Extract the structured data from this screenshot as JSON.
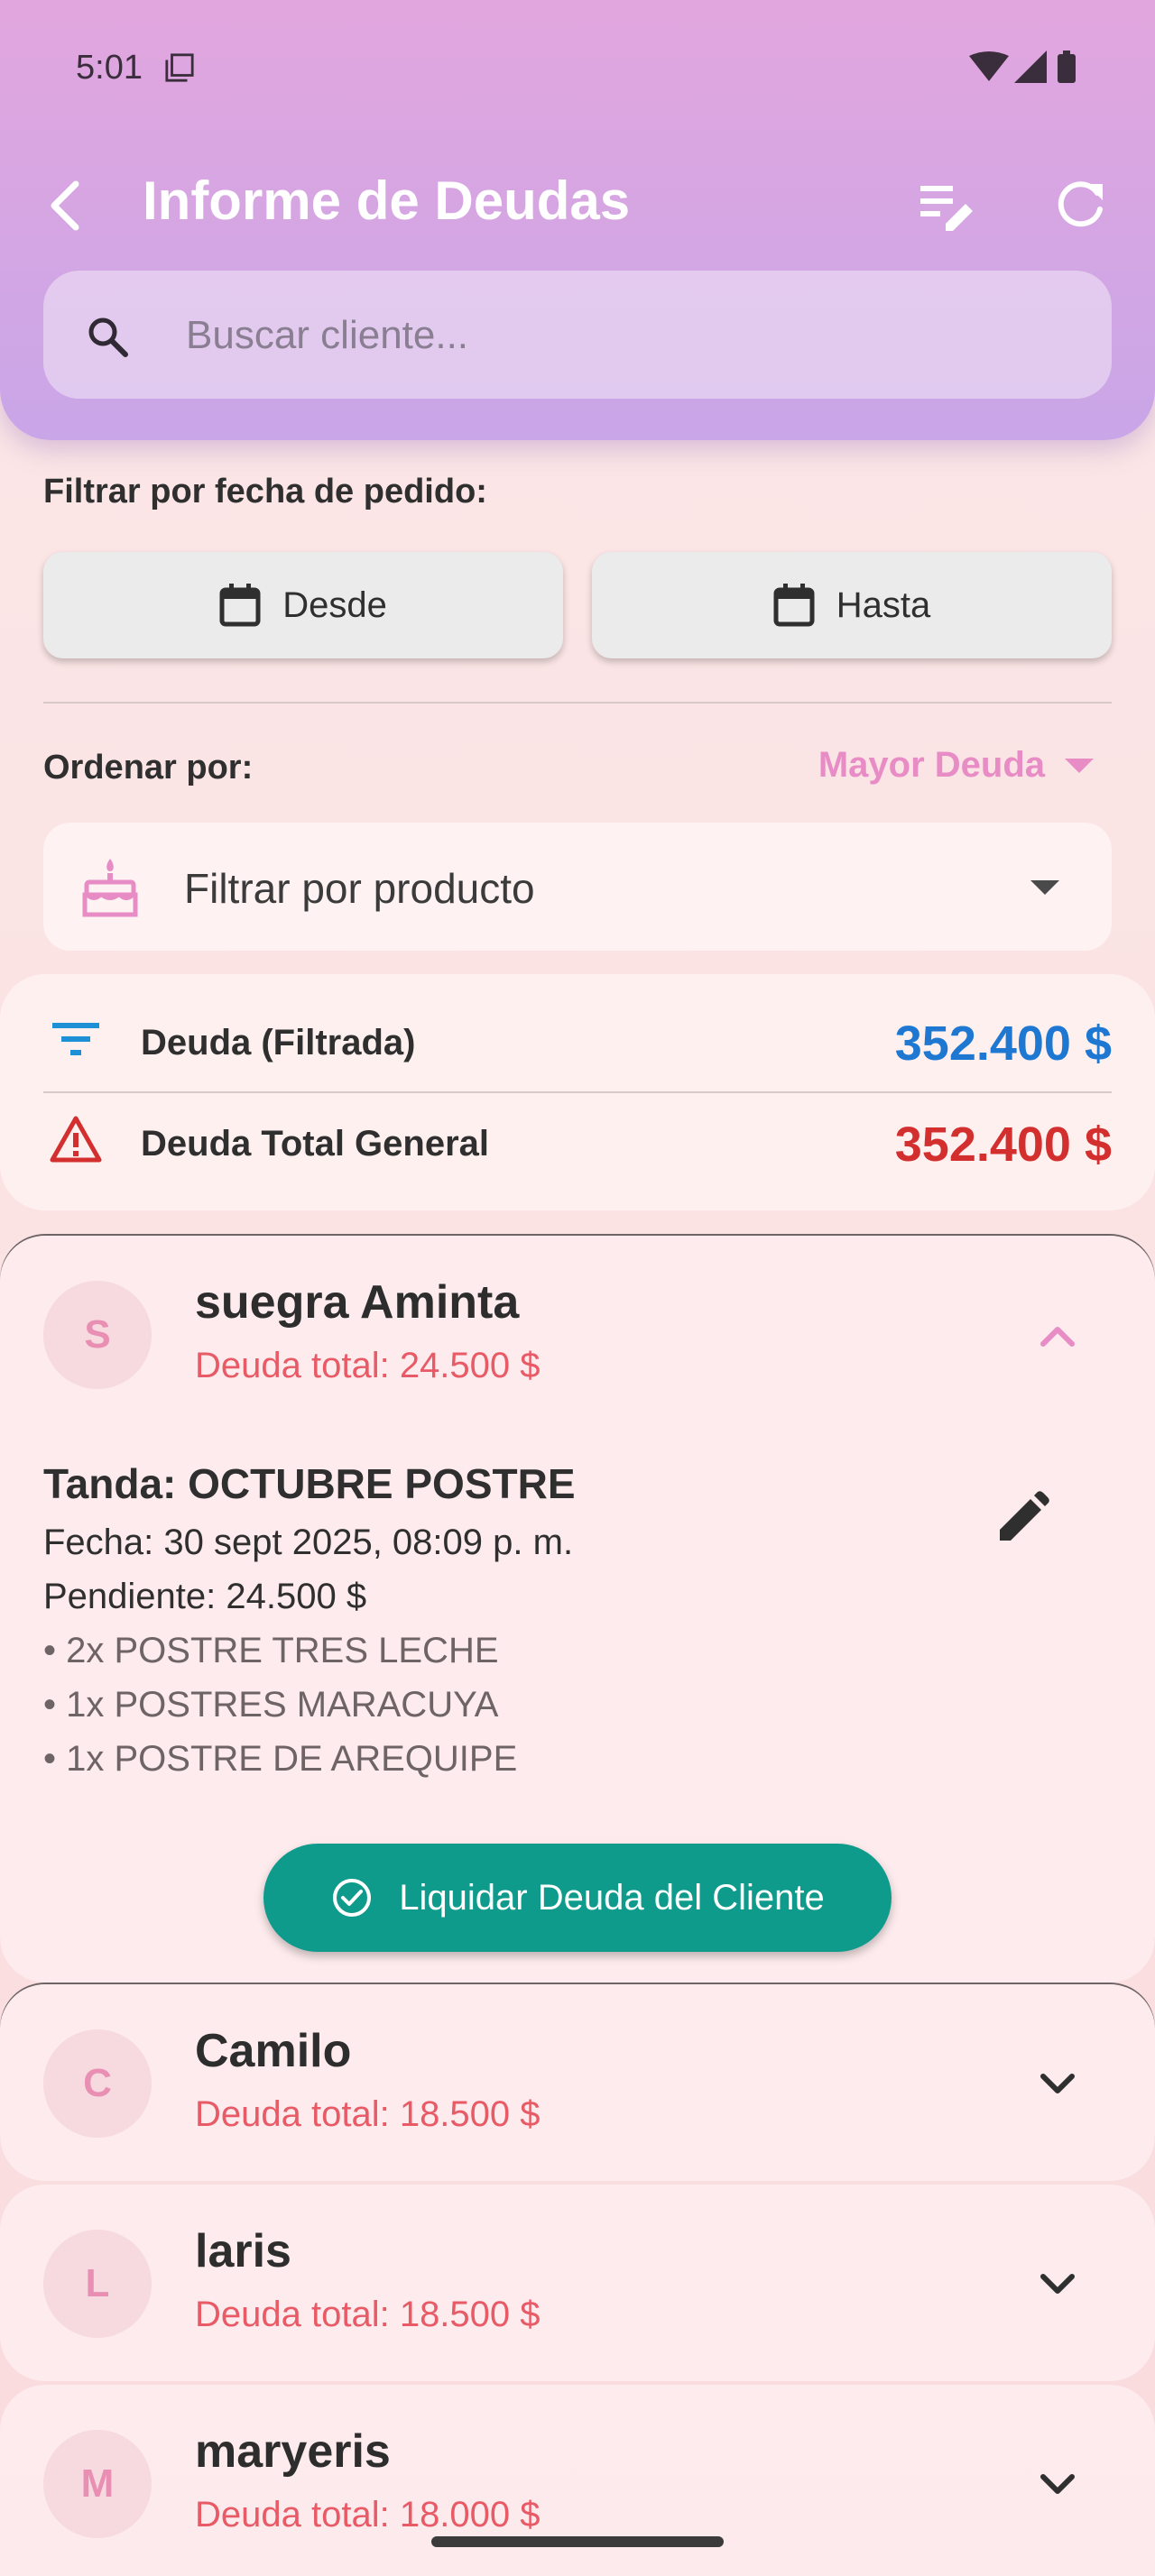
{
  "status_bar": {
    "time": "5:01"
  },
  "header": {
    "title": "Informe de Deudas"
  },
  "search": {
    "placeholder": "Buscar cliente..."
  },
  "date_filter": {
    "label": "Filtrar por fecha de pedido:",
    "from_label": "Desde",
    "to_label": "Hasta"
  },
  "sort": {
    "label": "Ordenar por:",
    "value": "Mayor Deuda"
  },
  "product_filter": {
    "label": "Filtrar por producto"
  },
  "summary": {
    "filtered_label": "Deuda (Filtrada)",
    "filtered_value": "352.400 $",
    "total_label": "Deuda Total General",
    "total_value": "352.400 $",
    "filtered_color": "#1e78d2",
    "total_color": "#d32f2f"
  },
  "clients": [
    {
      "initial": "S",
      "name": "suegra Aminta",
      "debt": "Deuda total: 24.500 $",
      "expanded": true,
      "batch": {
        "title": "Tanda: OCTUBRE POSTRE",
        "date": "Fecha: 30 sept 2025, 08:09 p. m.",
        "pending": "Pendiente: 24.500 $",
        "items": [
          "• 2x POSTRE TRES LECHE",
          "• 1x POSTRES MARACUYA",
          "• 1x POSTRE DE AREQUIPE"
        ]
      },
      "settle_label": "Liquidar Deuda del Cliente"
    },
    {
      "initial": "C",
      "name": "Camilo",
      "debt": "Deuda total: 18.500 $"
    },
    {
      "initial": "L",
      "name": "laris",
      "debt": "Deuda total: 18.500 $"
    },
    {
      "initial": "M",
      "name": "maryeris",
      "debt": "Deuda total: 18.000 $"
    }
  ],
  "colors": {
    "accent": "#e88cc6",
    "settle_button": "#0e9b8c",
    "debt_text": "#e85a66"
  }
}
